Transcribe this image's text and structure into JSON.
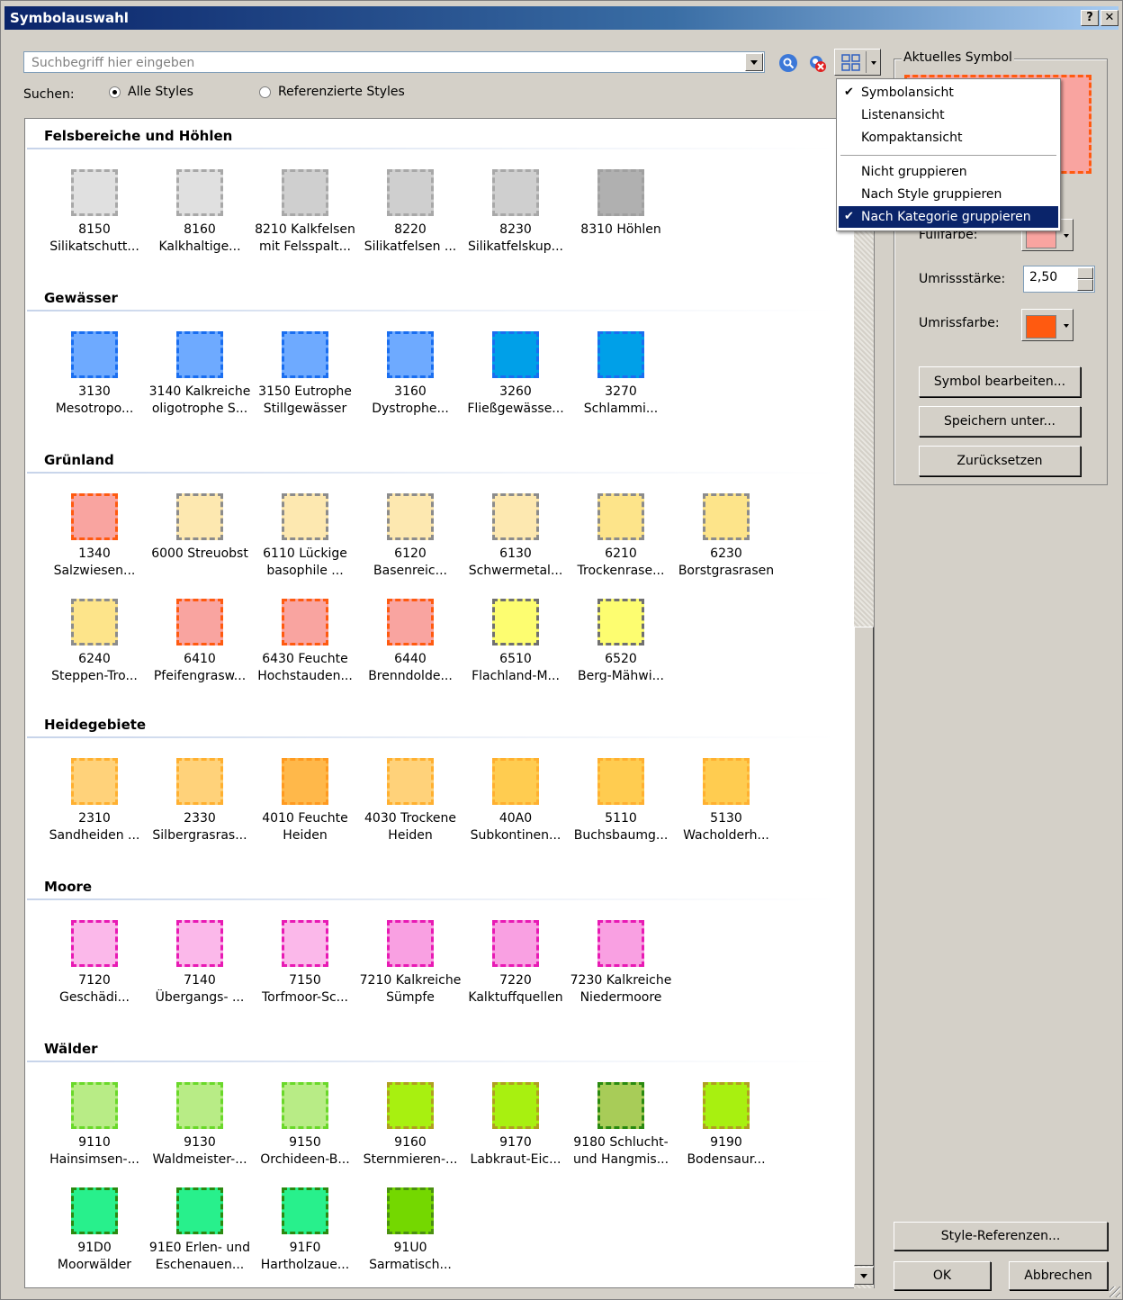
{
  "window": {
    "title": "Symbolauswahl",
    "help": "?",
    "close": "✕"
  },
  "search": {
    "placeholder": "Suchbegriff hier eingeben",
    "label": "Suchen:",
    "option_all": "Alle Styles",
    "option_ref": "Referenzierte Styles",
    "selected": "Alle Styles"
  },
  "menu": {
    "items": [
      {
        "label": "Symbolansicht",
        "checked": true
      },
      {
        "label": "Listenansicht",
        "checked": false
      },
      {
        "label": "Kompaktansicht",
        "checked": false
      },
      {
        "label": "Nicht gruppieren",
        "checked": false
      },
      {
        "label": "Nach Style gruppieren",
        "checked": false
      },
      {
        "label": "Nach Kategorie gruppieren",
        "checked": true
      }
    ]
  },
  "current": {
    "legend": "Aktuelles Symbol",
    "fill_label": "Füllfarbe:",
    "fill_color": "#f9a4a0",
    "outline_width_label": "Umrissstärke:",
    "outline_width": "2,50",
    "outline_color_label": "Umrissfarbe:",
    "outline_color": "#ff5a10",
    "edit_btn": "Symbol bearbeiten...",
    "save_btn": "Speichern unter...",
    "reset_btn": "Zurücksetzen"
  },
  "footer": {
    "ref_btn": "Style-Referenzen...",
    "ok_btn": "OK",
    "cancel_btn": "Abbrechen"
  },
  "categories": [
    {
      "name": "Felsbereiche und Höhlen",
      "items": [
        {
          "l1": "8150",
          "l2": "Silikatschutt...",
          "fill": "#e0e0e0",
          "stroke": "#a8a8a8"
        },
        {
          "l1": "8160",
          "l2": "Kalkhaltige...",
          "fill": "#e0e0e0",
          "stroke": "#a8a8a8"
        },
        {
          "l1": "8210 Kalkfelsen",
          "l2": "mit Felsspalt...",
          "fill": "#cfcfcf",
          "stroke": "#a8a8a8"
        },
        {
          "l1": "8220",
          "l2": "Silikatfelsen ...",
          "fill": "#cfcfcf",
          "stroke": "#a8a8a8"
        },
        {
          "l1": "8230",
          "l2": "Silikatfelskup...",
          "fill": "#cfcfcf",
          "stroke": "#a8a8a8"
        },
        {
          "l1": "8310 Höhlen",
          "l2": "",
          "fill": "#b0b0b0",
          "stroke": "#a0a0a0"
        }
      ]
    },
    {
      "name": "Gewässer",
      "items": [
        {
          "l1": "3130",
          "l2": "Mesotropo...",
          "fill": "#6eaaff",
          "stroke": "#1a6ef0"
        },
        {
          "l1": "3140 Kalkreiche",
          "l2": "oligotrophe S...",
          "fill": "#6eaaff",
          "stroke": "#1a6ef0"
        },
        {
          "l1": "3150 Eutrophe",
          "l2": "Stillgewässer",
          "fill": "#6eaaff",
          "stroke": "#1a6ef0"
        },
        {
          "l1": "3160",
          "l2": "Dystrophe...",
          "fill": "#6eaaff",
          "stroke": "#1a6ef0"
        },
        {
          "l1": "3260",
          "l2": "Fließgewässe...",
          "fill": "#00a0e8",
          "stroke": "#1a6ef0"
        },
        {
          "l1": "3270",
          "l2": "Schlammi...",
          "fill": "#00a0e8",
          "stroke": "#1a6ef0"
        }
      ]
    },
    {
      "name": "Grünland",
      "items": [
        {
          "l1": "1340",
          "l2": "Salzwiesen...",
          "fill": "#f9a4a0",
          "stroke": "#ff5a10"
        },
        {
          "l1": "6000 Streuobst",
          "l2": "",
          "fill": "#fde8b0",
          "stroke": "#8c8c8c"
        },
        {
          "l1": "6110 Lückige",
          "l2": "basophile ...",
          "fill": "#fde8b0",
          "stroke": "#8c8c8c"
        },
        {
          "l1": "6120",
          "l2": "Basenreic...",
          "fill": "#fde8b0",
          "stroke": "#8c8c8c"
        },
        {
          "l1": "6130",
          "l2": "Schwermetal...",
          "fill": "#fde8b0",
          "stroke": "#8c8c8c"
        },
        {
          "l1": "6210",
          "l2": "Trockenrase...",
          "fill": "#fde48a",
          "stroke": "#8c8c8c"
        },
        {
          "l1": "6230",
          "l2": "Borstgrasrasen",
          "fill": "#fde48a",
          "stroke": "#8c8c8c"
        },
        {
          "l1": "6240",
          "l2": "Steppen-Tro...",
          "fill": "#fde48a",
          "stroke": "#8c8c8c"
        },
        {
          "l1": "6410",
          "l2": "Pfeifengrasw...",
          "fill": "#f9a4a0",
          "stroke": "#ff5a10"
        },
        {
          "l1": "6430 Feuchte",
          "l2": "Hochstauden...",
          "fill": "#f9a4a0",
          "stroke": "#ff5a10"
        },
        {
          "l1": "6440",
          "l2": "Brenndolde...",
          "fill": "#f9a4a0",
          "stroke": "#ff5a10"
        },
        {
          "l1": "6510",
          "l2": "Flachland-M...",
          "fill": "#fdfd70",
          "stroke": "#707070"
        },
        {
          "l1": "6520",
          "l2": "Berg-Mähwi...",
          "fill": "#fdfd70",
          "stroke": "#707070"
        }
      ]
    },
    {
      "name": "Heidegebiete",
      "items": [
        {
          "l1": "2310",
          "l2": "Sandheiden ...",
          "fill": "#ffd27a",
          "stroke": "#ffb030"
        },
        {
          "l1": "2330",
          "l2": "Silbergrasras...",
          "fill": "#ffd27a",
          "stroke": "#ffb030"
        },
        {
          "l1": "4010 Feuchte",
          "l2": "Heiden",
          "fill": "#ffb84a",
          "stroke": "#ff9a20"
        },
        {
          "l1": "4030 Trockene",
          "l2": "Heiden",
          "fill": "#ffd27a",
          "stroke": "#ffb030"
        },
        {
          "l1": "40A0",
          "l2": "Subkontinen...",
          "fill": "#ffcc50",
          "stroke": "#ffb030"
        },
        {
          "l1": "5110",
          "l2": "Buchsbaumg...",
          "fill": "#ffcc50",
          "stroke": "#ffb030"
        },
        {
          "l1": "5130",
          "l2": "Wacholderh...",
          "fill": "#ffcc50",
          "stroke": "#ffb030"
        }
      ]
    },
    {
      "name": "Moore",
      "items": [
        {
          "l1": "7120",
          "l2": "Geschädi...",
          "fill": "#fbb8ea",
          "stroke": "#e81ab4"
        },
        {
          "l1": "7140",
          "l2": "Übergangs- ...",
          "fill": "#fbb8ea",
          "stroke": "#e81ab4"
        },
        {
          "l1": "7150",
          "l2": "Torfmoor-Sc...",
          "fill": "#fbb8ea",
          "stroke": "#e81ab4"
        },
        {
          "l1": "7210 Kalkreiche",
          "l2": "Sümpfe",
          "fill": "#f9a0e2",
          "stroke": "#e81ab4"
        },
        {
          "l1": "7220",
          "l2": "Kalktuffquellen",
          "fill": "#f9a0e2",
          "stroke": "#e81ab4"
        },
        {
          "l1": "7230 Kalkreiche",
          "l2": "Niedermoore",
          "fill": "#f9a0e2",
          "stroke": "#e81ab4"
        }
      ]
    },
    {
      "name": "Wälder",
      "items": [
        {
          "l1": "9110",
          "l2": "Hainsimsen-...",
          "fill": "#b8ec86",
          "stroke": "#6ad82a"
        },
        {
          "l1": "9130",
          "l2": "Waldmeister-...",
          "fill": "#b8ec86",
          "stroke": "#6ad82a"
        },
        {
          "l1": "9150",
          "l2": "Orchideen-B...",
          "fill": "#b8ec86",
          "stroke": "#6ad82a"
        },
        {
          "l1": "9160",
          "l2": "Sternmieren-...",
          "fill": "#a8f010",
          "stroke": "#b0a020"
        },
        {
          "l1": "9170",
          "l2": "Labkraut-Eic...",
          "fill": "#a8f010",
          "stroke": "#b0a020"
        },
        {
          "l1": "9180 Schlucht-",
          "l2": "und Hangmis...",
          "fill": "#a8cc58",
          "stroke": "#2a8a10"
        },
        {
          "l1": "9190",
          "l2": "Bodensaur...",
          "fill": "#a8f010",
          "stroke": "#b0a020"
        },
        {
          "l1": "91D0",
          "l2": "Moorwälder",
          "fill": "#28f08c",
          "stroke": "#2a8a10"
        },
        {
          "l1": "91E0 Erlen- und",
          "l2": "Eschenauen...",
          "fill": "#28f08c",
          "stroke": "#2a8a10"
        },
        {
          "l1": "91F0",
          "l2": "Hartholzaue...",
          "fill": "#28f08c",
          "stroke": "#2a8a10"
        },
        {
          "l1": "91U0",
          "l2": "Sarmatisch...",
          "fill": "#74d800",
          "stroke": "#4a9010"
        }
      ]
    }
  ]
}
